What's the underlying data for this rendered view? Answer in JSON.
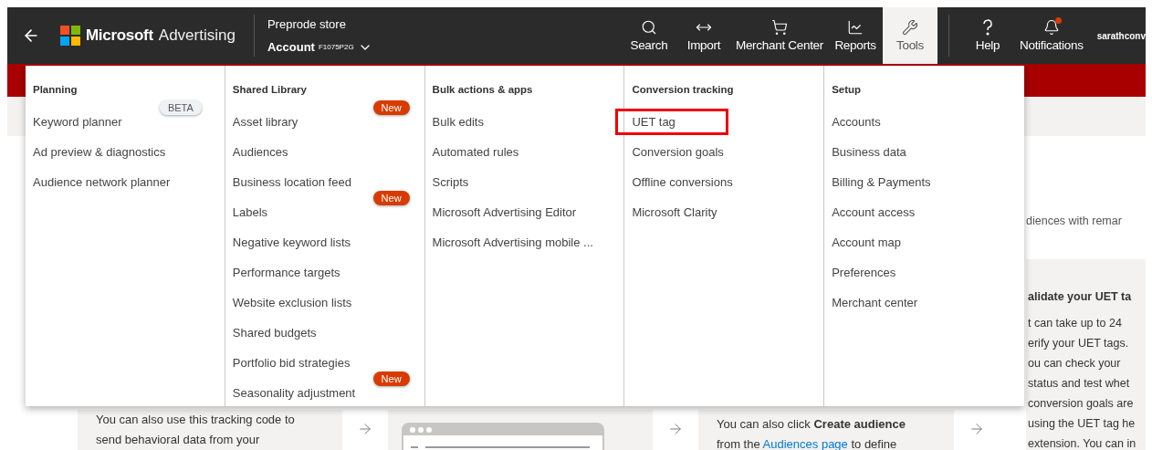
{
  "header": {
    "brand": {
      "name": "Microsoft",
      "product": "Advertising"
    },
    "store": "Preprode store",
    "account": {
      "label": "Account",
      "id": "F1075P2G"
    },
    "nav": [
      {
        "label": "Search",
        "kind": "search",
        "selected": false,
        "dot": false
      },
      {
        "label": "Import",
        "kind": "import",
        "selected": false,
        "dot": false
      },
      {
        "label": "Merchant Center",
        "kind": "cart",
        "selected": false,
        "dot": false
      },
      {
        "label": "Reports",
        "kind": "chart",
        "selected": false,
        "dot": false
      },
      {
        "label": "Tools",
        "kind": "tools",
        "selected": true,
        "dot": false
      },
      {
        "label": "Help",
        "kind": "help",
        "selected": false,
        "dot": false
      },
      {
        "label": "Notifications",
        "kind": "notifications",
        "selected": false,
        "dot": true
      }
    ],
    "user": "sarathconv"
  },
  "menu": [
    {
      "title": "Planning",
      "items": [
        {
          "label": "Keyword planner",
          "badge": {
            "text": "BETA",
            "kind": "beta"
          },
          "highlighted": false
        },
        {
          "label": "Ad preview & diagnostics",
          "highlighted": false
        },
        {
          "label": "Audience network planner",
          "highlighted": false
        }
      ]
    },
    {
      "title": "Shared Library",
      "items": [
        {
          "label": "Asset library",
          "badge": {
            "text": "New",
            "kind": "new"
          },
          "highlighted": false
        },
        {
          "label": "Audiences",
          "highlighted": false
        },
        {
          "label": "Business location feed",
          "highlighted": false
        },
        {
          "label": "Labels",
          "badge": {
            "text": "New",
            "kind": "new"
          },
          "highlighted": false
        },
        {
          "label": "Negative keyword lists",
          "highlighted": false
        },
        {
          "label": "Performance targets",
          "highlighted": false
        },
        {
          "label": "Website exclusion lists",
          "highlighted": false
        },
        {
          "label": "Shared budgets",
          "highlighted": false
        },
        {
          "label": "Portfolio bid strategies",
          "highlighted": false
        },
        {
          "label": "Seasonality adjustment",
          "badge": {
            "text": "New",
            "kind": "new"
          },
          "highlighted": false
        }
      ]
    },
    {
      "title": "Bulk actions & apps",
      "items": [
        {
          "label": "Bulk edits",
          "highlighted": false
        },
        {
          "label": "Automated rules",
          "highlighted": false
        },
        {
          "label": "Scripts",
          "highlighted": false
        },
        {
          "label": "Microsoft Advertising Editor",
          "highlighted": false
        },
        {
          "label": "Microsoft Advertising mobile ...",
          "highlighted": false
        }
      ]
    },
    {
      "title": "Conversion tracking",
      "items": [
        {
          "label": "UET tag",
          "highlighted": true
        },
        {
          "label": "Conversion goals",
          "highlighted": false
        },
        {
          "label": "Offline conversions",
          "highlighted": false
        },
        {
          "label": "Microsoft Clarity",
          "highlighted": false
        }
      ]
    },
    {
      "title": "Setup",
      "items": [
        {
          "label": "Accounts",
          "highlighted": false
        },
        {
          "label": "Business data",
          "highlighted": false
        },
        {
          "label": "Billing & Payments",
          "highlighted": false
        },
        {
          "label": "Account access",
          "highlighted": false
        },
        {
          "label": "Account map",
          "highlighted": false
        },
        {
          "label": "Preferences",
          "highlighted": false
        },
        {
          "label": "Merchant center",
          "highlighted": false
        }
      ]
    }
  ],
  "page": {
    "side_note": "diences with remar",
    "tracking_card": {
      "lines": [
        "You can also use this tracking code to",
        "send behavioral data from your"
      ]
    },
    "audience_card": {
      "lines": [
        "You can also click **Create audience**"
      ],
      "link_line": {
        "before": "from the ",
        "link": "Audiences page",
        "after": " to define"
      }
    },
    "validate_card": {
      "title": "alidate your UET ta",
      "lines": [
        "t can take up to 24",
        "erify your UET tags.",
        "ou can check your",
        "status and test whet",
        "conversion goals are",
        "using the UET tag he",
        "extension. You can in"
      ]
    }
  }
}
